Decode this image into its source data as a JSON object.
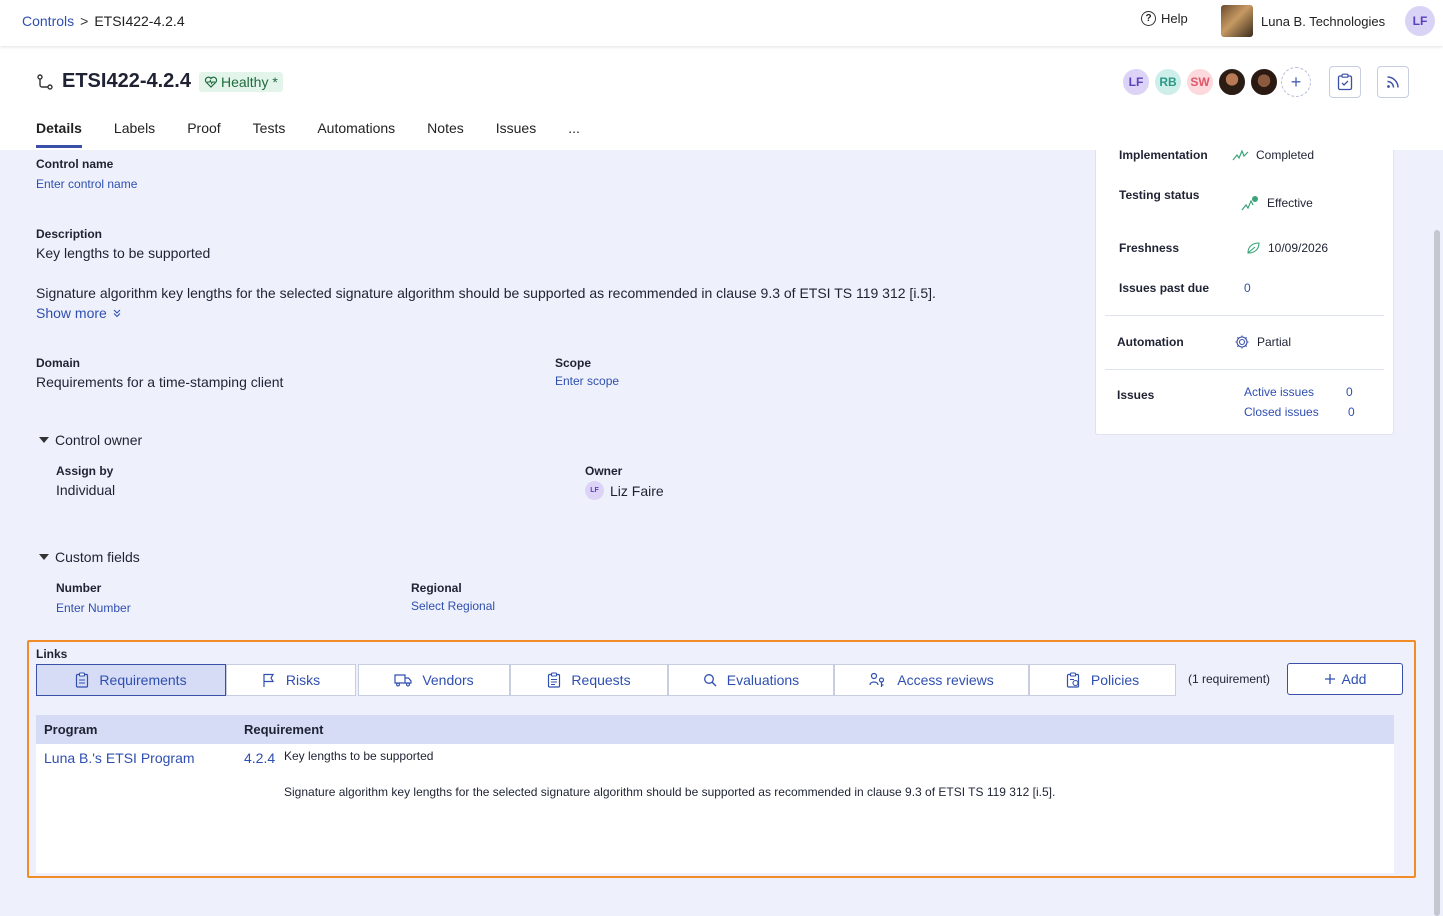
{
  "breadcrumb": {
    "parent": "Controls",
    "separator": ">",
    "current": "ETSI422-4.2.4"
  },
  "topbar": {
    "help": "Help",
    "org_name": "Luna B. Technologies",
    "user_initials": "LF"
  },
  "header": {
    "title": "ETSI422-4.2.4",
    "health_label": "Healthy *",
    "avatars": [
      "LF",
      "RB",
      "SW"
    ],
    "add_member": "+"
  },
  "tabs": [
    "Details",
    "Labels",
    "Proof",
    "Tests",
    "Automations",
    "Notes",
    "Issues",
    "..."
  ],
  "details": {
    "control_name_label": "Control name",
    "control_name_placeholder": "Enter control name",
    "description_label": "Description",
    "description_title": "Key lengths to be supported",
    "description_body": "Signature algorithm key lengths for the selected signature algorithm should be supported as recommended in clause 9.3 of ETSI TS 119 312 [i.5].",
    "show_more": "Show more",
    "domain_label": "Domain",
    "domain_value": "Requirements for a time-stamping client",
    "scope_label": "Scope",
    "scope_placeholder": "Enter scope"
  },
  "control_owner": {
    "heading": "Control owner",
    "assign_by_label": "Assign by",
    "assign_by_value": "Individual",
    "owner_label": "Owner",
    "owner_initials": "LF",
    "owner_name": "Liz Faire"
  },
  "custom_fields": {
    "heading": "Custom fields",
    "number_label": "Number",
    "number_placeholder": "Enter Number",
    "regional_label": "Regional",
    "regional_placeholder": "Select Regional"
  },
  "panel": {
    "implementation_label": "Implementation",
    "implementation_value": "Completed",
    "testing_label": "Testing status",
    "testing_value": "Effective",
    "freshness_label": "Freshness",
    "freshness_value": "10/09/2026",
    "past_due_label": "Issues past due",
    "past_due_value": "0",
    "automation_label": "Automation",
    "automation_value": "Partial",
    "issues_label": "Issues",
    "active_issues_label": "Active issues",
    "active_issues_count": "0",
    "closed_issues_label": "Closed issues",
    "closed_issues_count": "0"
  },
  "links": {
    "heading": "Links",
    "tabs": [
      "Requirements",
      "Risks",
      "Vendors",
      "Requests",
      "Evaluations",
      "Access reviews",
      "Policies"
    ],
    "count_text": "(1 requirement)",
    "add_label": "Add",
    "columns": [
      "Program",
      "Requirement"
    ],
    "rows": [
      {
        "program": "Luna B.'s ETSI Program",
        "req_id": "4.2.4",
        "req_title": "Key lengths to be supported",
        "req_body": "Signature algorithm key lengths for the selected signature algorithm should be supported as recommended in clause 9.3 of ETSI TS 119 312 [i.5]."
      }
    ]
  },
  "colors": {
    "accent": "#3a4fa8",
    "link": "#2f4fb0",
    "highlight": "#f28c28",
    "healthy_bg": "#e3f5ea"
  }
}
